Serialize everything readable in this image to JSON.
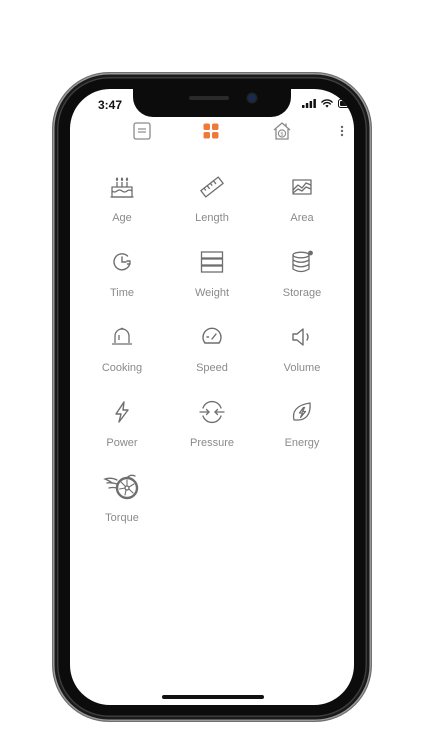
{
  "status_bar": {
    "time": "3:47"
  },
  "toolbar": {
    "accent_color": "#ee7a3a",
    "items": [
      {
        "icon": "list-icon"
      },
      {
        "icon": "grid-icon",
        "active": true
      },
      {
        "icon": "currency-house-icon"
      },
      {
        "icon": "more-icon"
      }
    ]
  },
  "categories": [
    {
      "label": "Age",
      "icon": "cake-icon"
    },
    {
      "label": "Length",
      "icon": "ruler-icon"
    },
    {
      "label": "Area",
      "icon": "area-chart-icon"
    },
    {
      "label": "Time",
      "icon": "clock-icon"
    },
    {
      "label": "Weight",
      "icon": "weight-stack-icon"
    },
    {
      "label": "Storage",
      "icon": "database-icon"
    },
    {
      "label": "Cooking",
      "icon": "cloche-icon"
    },
    {
      "label": "Speed",
      "icon": "speedometer-icon"
    },
    {
      "label": "Volume",
      "icon": "speaker-icon"
    },
    {
      "label": "Power",
      "icon": "lightning-icon"
    },
    {
      "label": "Pressure",
      "icon": "pressure-icon"
    },
    {
      "label": "Energy",
      "icon": "leaf-bolt-icon"
    },
    {
      "label": "Torque",
      "icon": "turbo-icon"
    }
  ]
}
